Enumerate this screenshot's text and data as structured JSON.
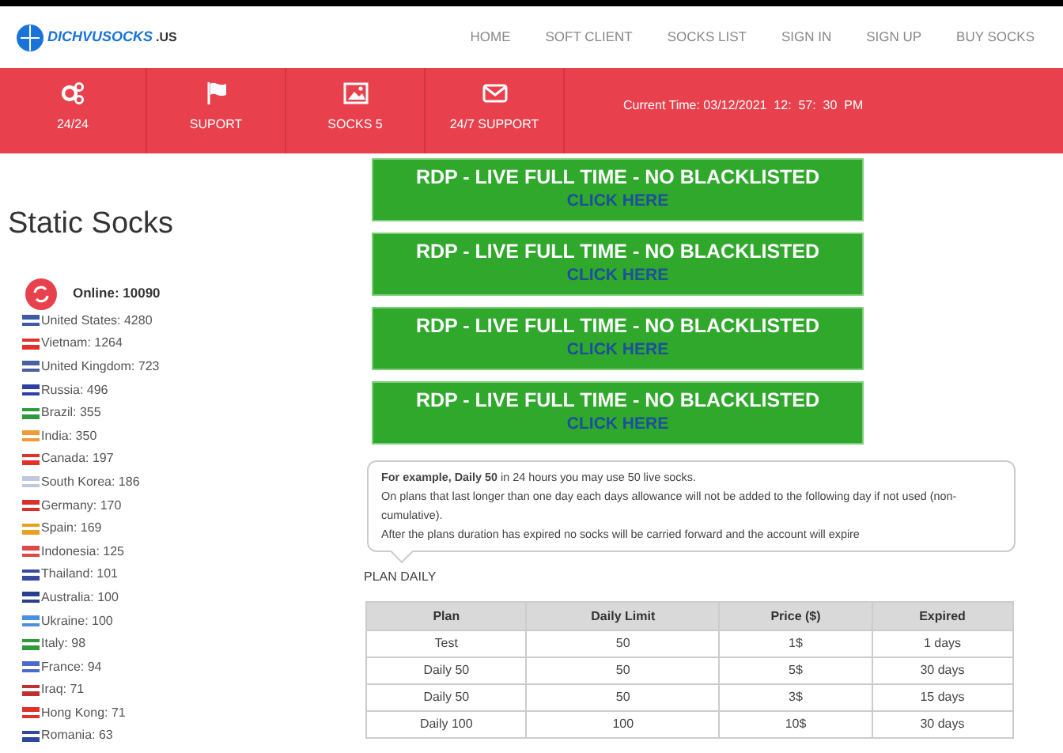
{
  "logo": {
    "text": "DICHVUSOCKS",
    "suffix": ".US"
  },
  "nav": [
    "HOME",
    "SOFT CLIENT",
    "SOCKS LIST",
    "SIGN IN",
    "SIGN UP",
    "BUY SOCKS"
  ],
  "features": [
    {
      "kind": "gears",
      "label": "24/24"
    },
    {
      "kind": "flag",
      "label": "SUPORT"
    },
    {
      "kind": "image",
      "label": "SOCKS 5"
    },
    {
      "kind": "mail",
      "label": "24/7 SUPPORT"
    }
  ],
  "current_time": "Current Time: 03/12/2021  12:  57:  30  PM",
  "sidebar": {
    "title": "Static Socks",
    "online": "Online: 10090",
    "countries": [
      {
        "label": "United States: 4280",
        "color": "#3c5aa6"
      },
      {
        "label": "Vietnam: 1264",
        "color": "#e0312a"
      },
      {
        "label": "United Kingdom: 723",
        "color": "#4a5fa0"
      },
      {
        "label": "Russia: 496",
        "color": "#2d3fa8"
      },
      {
        "label": "Brazil: 355",
        "color": "#2e9a3c"
      },
      {
        "label": "India: 350",
        "color": "#f29a36"
      },
      {
        "label": "Canada: 197",
        "color": "#e0312a"
      },
      {
        "label": "South Korea: 186",
        "color": "#c0c8e0"
      },
      {
        "label": "Germany: 170",
        "color": "#d8302a"
      },
      {
        "label": "Spain: 169",
        "color": "#e8a020"
      },
      {
        "label": "Indonesia: 125",
        "color": "#e04848"
      },
      {
        "label": "Thailand: 101",
        "color": "#3a4aa0"
      },
      {
        "label": "Australia: 100",
        "color": "#283e8e"
      },
      {
        "label": "Ukraine: 100",
        "color": "#4a8fe0"
      },
      {
        "label": "Italy: 98",
        "color": "#2e9a3c"
      },
      {
        "label": "France: 94",
        "color": "#4a6ad0"
      },
      {
        "label": "Iraq: 71",
        "color": "#c03030"
      },
      {
        "label": "Hong Kong: 71",
        "color": "#e0312a"
      },
      {
        "label": "Romania: 63",
        "color": "#2c48a0"
      }
    ]
  },
  "banners": [
    {
      "title": "RDP - LIVE FULL TIME - NO BLACKLISTED",
      "link": "CLICK HERE"
    },
    {
      "title": "RDP - LIVE FULL TIME - NO BLACKLISTED",
      "link": "CLICK HERE"
    },
    {
      "title": "RDP - LIVE FULL TIME - NO BLACKLISTED",
      "link": "CLICK HERE"
    },
    {
      "title": "RDP - LIVE FULL TIME - NO BLACKLISTED",
      "link": "CLICK HERE"
    }
  ],
  "note": [
    "**For example, Daily 50** in 24 hours you may use 50 live socks.",
    "On plans that last longer than one day each days allowance will not be added to the following day if not used (non-cumulative).",
    "After the plans duration has expired no socks will be carried forward and the account will expire"
  ],
  "plan_title": "PLAN DAILY",
  "table": {
    "columns": [
      "Plan",
      "Daily Limit",
      "Price ($)",
      "Expired"
    ],
    "rows": [
      [
        "Test",
        "50",
        "1$",
        "1 days"
      ],
      [
        "Daily 50",
        "50",
        "5$",
        "30 days"
      ],
      [
        "Daily 50",
        "50",
        "3$",
        "15 days"
      ],
      [
        "Daily 100",
        "100",
        "10$",
        "30 days"
      ]
    ]
  }
}
